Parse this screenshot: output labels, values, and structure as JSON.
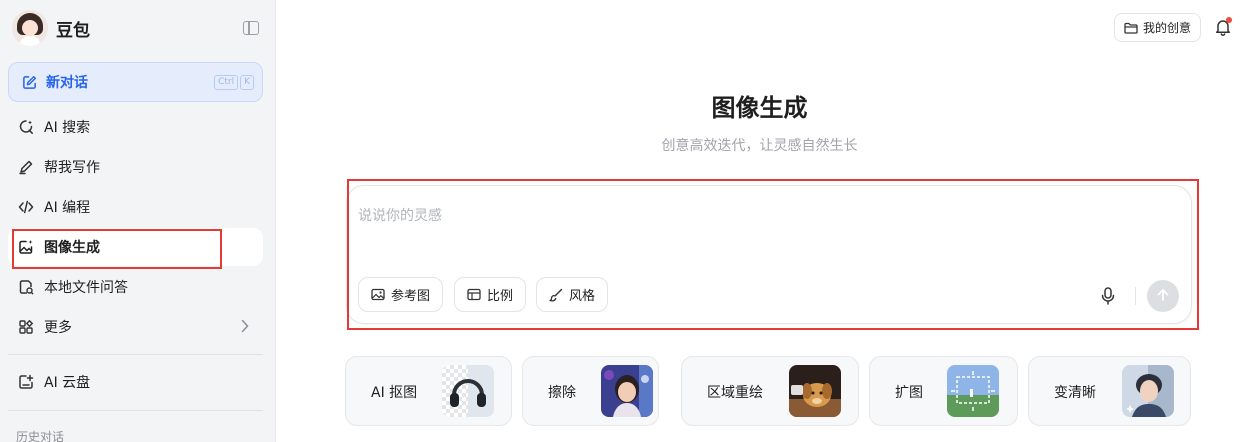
{
  "app": {
    "name": "豆包"
  },
  "sidebar": {
    "new_chat": {
      "label": "新对话",
      "shortcut": [
        "Ctrl",
        "K"
      ]
    },
    "items": [
      {
        "label": "AI 搜索",
        "icon": "search-spark-icon"
      },
      {
        "label": "帮我写作",
        "icon": "pen-icon"
      },
      {
        "label": "AI 编程",
        "icon": "code-icon"
      },
      {
        "label": "图像生成",
        "icon": "image-gen-icon",
        "active": true
      },
      {
        "label": "本地文件问答",
        "icon": "file-qa-icon"
      },
      {
        "label": "更多",
        "icon": "grid-icon",
        "chevron": "›"
      }
    ],
    "cloud": {
      "label": "AI 云盘",
      "icon": "cloud-drive-icon"
    },
    "history_title": "历史对话"
  },
  "header": {
    "my_creation_label": "我的创意",
    "notification_icon": "bell-icon"
  },
  "main": {
    "title": "图像生成",
    "subtitle": "创意高效迭代，让灵感自然生长",
    "composer": {
      "placeholder": "说说你的灵感",
      "chips": [
        {
          "label": "参考图",
          "icon": "image-ref-icon"
        },
        {
          "label": "比例",
          "icon": "ratio-icon"
        },
        {
          "label": "风格",
          "icon": "brush-icon"
        }
      ]
    },
    "tools": [
      {
        "label": "AI 抠图"
      },
      {
        "label": "擦除"
      },
      {
        "label": "区域重绘"
      },
      {
        "label": "扩图"
      },
      {
        "label": "变清晰"
      }
    ]
  },
  "colors": {
    "accent": "#2563eb",
    "sidebar_bg": "#f3f4f6",
    "highlight": "#e53935"
  }
}
